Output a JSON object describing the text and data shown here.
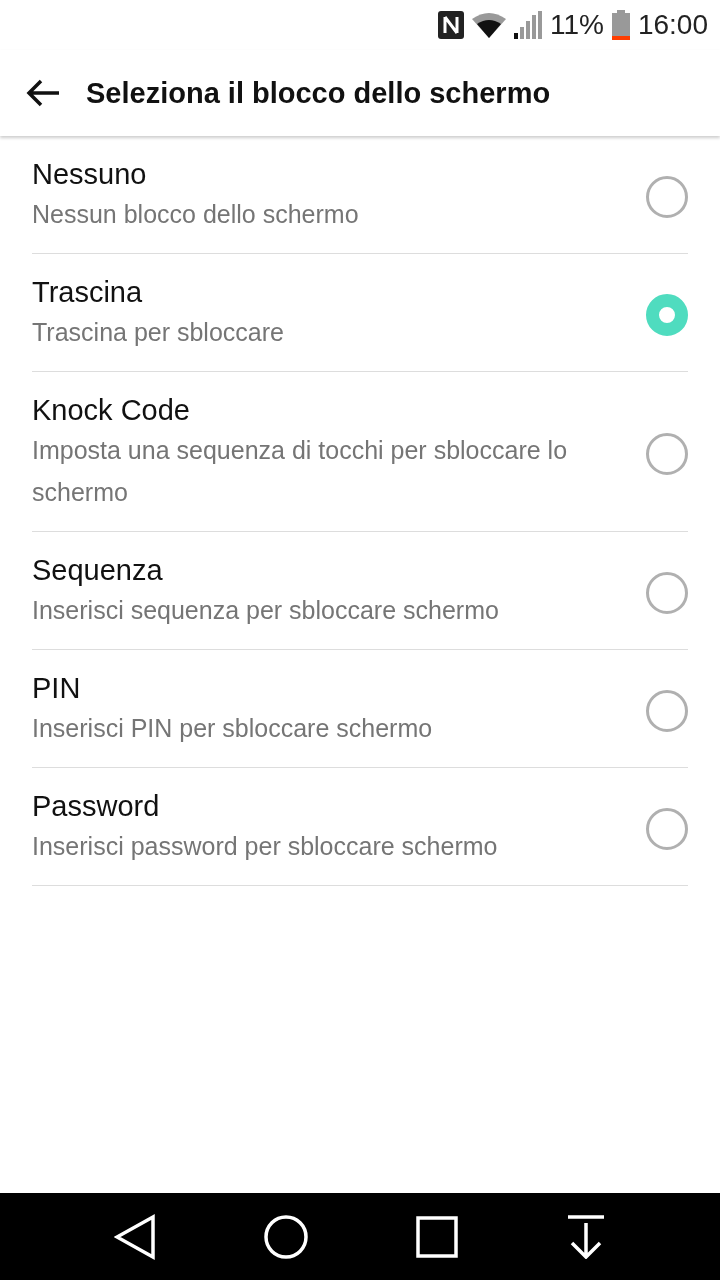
{
  "status_bar": {
    "battery": "11%",
    "time": "16:00"
  },
  "app_bar": {
    "title": "Seleziona il blocco dello schermo"
  },
  "options": [
    {
      "title": "Nessuno",
      "subtitle": "Nessun blocco dello schermo",
      "selected": false
    },
    {
      "title": "Trascina",
      "subtitle": "Trascina per sbloccare",
      "selected": true
    },
    {
      "title": "Knock Code",
      "subtitle": "Imposta una sequenza di tocchi per sbloccare lo schermo",
      "selected": false
    },
    {
      "title": "Sequenza",
      "subtitle": "Inserisci sequenza per sbloccare schermo",
      "selected": false
    },
    {
      "title": "PIN",
      "subtitle": "Inserisci PIN per sbloccare schermo",
      "selected": false
    },
    {
      "title": "Password",
      "subtitle": "Inserisci password per sbloccare schermo",
      "selected": false
    }
  ]
}
